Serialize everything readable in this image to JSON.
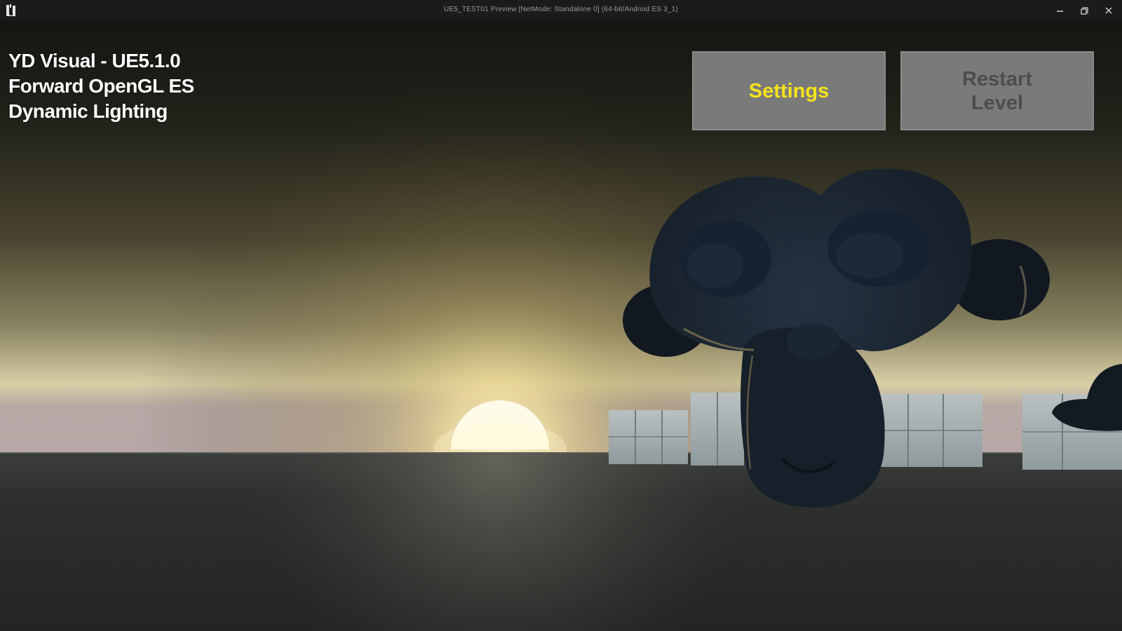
{
  "window": {
    "title": "UE5_TEST01 Preview [NetMode: Standalone 0]  (64-bit/Android ES 3_1)",
    "app_icon": "unreal-engine-logo",
    "controls": {
      "minimize_icon": "minimize-icon",
      "restore_icon": "restore-icon",
      "close_icon": "close-icon"
    }
  },
  "hud": {
    "line1": "YD Visual - UE5.1.0",
    "line2": "Forward OpenGL ES",
    "line3": "Dynamic Lighting"
  },
  "buttons": {
    "settings_label": "Settings",
    "restart_label": "Restart\nLevel"
  },
  "colors": {
    "settings_text": "#f6e31a",
    "restart_text": "#4d4d4d",
    "button_bg": "#7a7a7a",
    "titlebar_bg": "#1b1b1b"
  }
}
